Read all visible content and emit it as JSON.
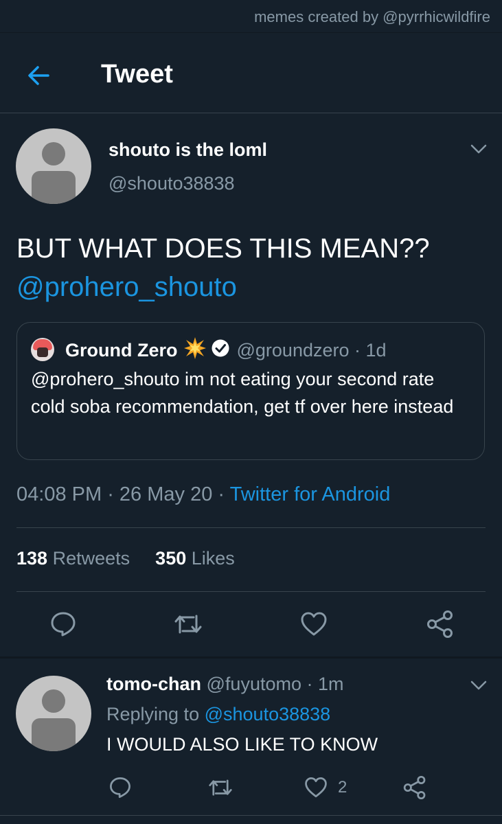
{
  "watermark": "memes created by @pyrrhicwildfire",
  "header": {
    "title": "Tweet",
    "back_icon": "arrow-left-icon"
  },
  "tweet": {
    "author_name": "shouto is the loml",
    "author_handle": "@shouto38838",
    "text": "BUT WHAT DOES THIS MEAN??",
    "mention": "@prohero_shouto",
    "quote": {
      "name": "Ground Zero",
      "handle": "@groundzero",
      "time": "1d",
      "text": "@prohero_shouto im not eating your second rate cold soba recommendation, get tf over here instead"
    },
    "time": "04:08 PM",
    "date": "26 May 20",
    "source": "Twitter for Android",
    "retweets_count": "138",
    "retweets_label": "Retweets",
    "likes_count": "350",
    "likes_label": "Likes"
  },
  "reply": {
    "name": "tomo-chan",
    "handle": "@fuyutomo",
    "time": "1m",
    "replying_to_label": "Replying to",
    "replying_to_handle": "@shouto38838",
    "text": "I WOULD ALSO LIKE TO KNOW",
    "like_count": "2"
  },
  "colors": {
    "background": "#15202b",
    "accent": "#1b95e0",
    "muted": "#8899a6",
    "border": "#38444d"
  }
}
